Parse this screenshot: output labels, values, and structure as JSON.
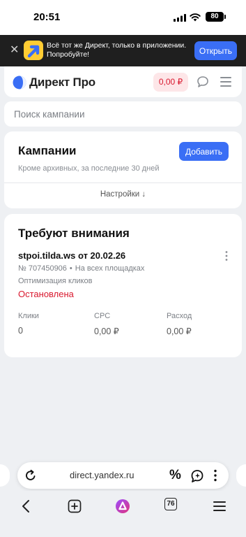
{
  "status_bar": {
    "time": "20:51",
    "battery": "80"
  },
  "app_banner": {
    "text": "Всё тот же Директ, только в приложении. Попробуйте!",
    "open_label": "Открыть"
  },
  "header": {
    "brand": "Директ Про",
    "balance": "0,00 ₽"
  },
  "search": {
    "placeholder": "Поиск кампании"
  },
  "campaigns": {
    "title": "Кампании",
    "add_label": "Добавить",
    "subtitle": "Кроме архивных, за последние 30 дней",
    "settings_label": "Настройки ↓"
  },
  "attention": {
    "title": "Требуют внимания",
    "campaign": {
      "name": "stpoi.tilda.ws от 20.02.26",
      "number": "№ 707450906",
      "placement": "На всех площадках",
      "strategy": "Оптимизация кликов",
      "status": "Остановлена",
      "stats": [
        {
          "label": "Клики",
          "value": "0"
        },
        {
          "label": "CPC",
          "value": "0,00 ₽"
        },
        {
          "label": "Расход",
          "value": "0,00 ₽"
        }
      ]
    }
  },
  "browser": {
    "url": "direct.yandex.ru",
    "tabs_count": "76"
  },
  "colors": {
    "accent": "#3a6ef5",
    "danger": "#d9182e",
    "alice": "#e0337d"
  }
}
